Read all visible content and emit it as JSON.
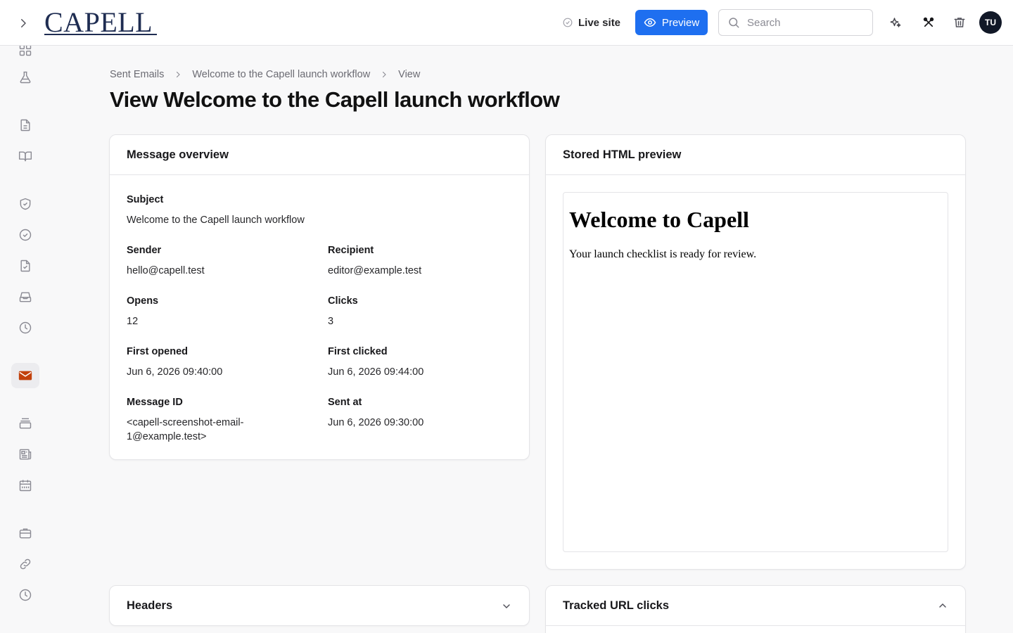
{
  "app": {
    "logo_text": "CAPELL"
  },
  "topbar": {
    "live_site_label": "Live site",
    "preview_label": "Preview",
    "search_placeholder": "Search",
    "avatar_initials": "TU"
  },
  "breadcrumb": {
    "items": [
      "Sent Emails",
      "Welcome to the Capell launch workflow",
      "View"
    ]
  },
  "page": {
    "title": "View Welcome to the Capell launch workflow"
  },
  "overview": {
    "heading": "Message overview",
    "subject_label": "Subject",
    "subject_value": "Welcome to the Capell launch workflow",
    "sender_label": "Sender",
    "sender_value": "hello@capell.test",
    "recipient_label": "Recipient",
    "recipient_value": "editor@example.test",
    "opens_label": "Opens",
    "opens_value": "12",
    "clicks_label": "Clicks",
    "clicks_value": "3",
    "first_opened_label": "First opened",
    "first_opened_value": "Jun 6, 2026 09:40:00",
    "first_clicked_label": "First clicked",
    "first_clicked_value": "Jun 6, 2026 09:44:00",
    "message_id_label": "Message ID",
    "message_id_line1": "<capell-screenshot-email-",
    "message_id_line2": "1@example.test>",
    "sent_at_label": "Sent at",
    "sent_at_value": "Jun 6, 2026 09:30:00"
  },
  "stored_preview": {
    "heading": "Stored HTML preview",
    "email_heading": "Welcome to Capell",
    "email_body": "Your launch checklist is ready for review."
  },
  "headers_section": {
    "heading": "Headers"
  },
  "tracked_section": {
    "heading": "Tracked URL clicks"
  },
  "colors": {
    "accent": "#1e6ff0",
    "active_nav": "#c2410c",
    "logo": "#1f2d52"
  },
  "sidebar_icons": [
    "dashboard-icon",
    "flask-icon",
    "document-icon",
    "book-icon",
    "shield-check-icon",
    "check-circle-icon",
    "file-check-icon",
    "inbox-icon",
    "clock-icon",
    "mail-icon",
    "archive-icon",
    "newspaper-icon",
    "calendar-icon",
    "briefcase-icon",
    "link-icon",
    "history-icon"
  ]
}
